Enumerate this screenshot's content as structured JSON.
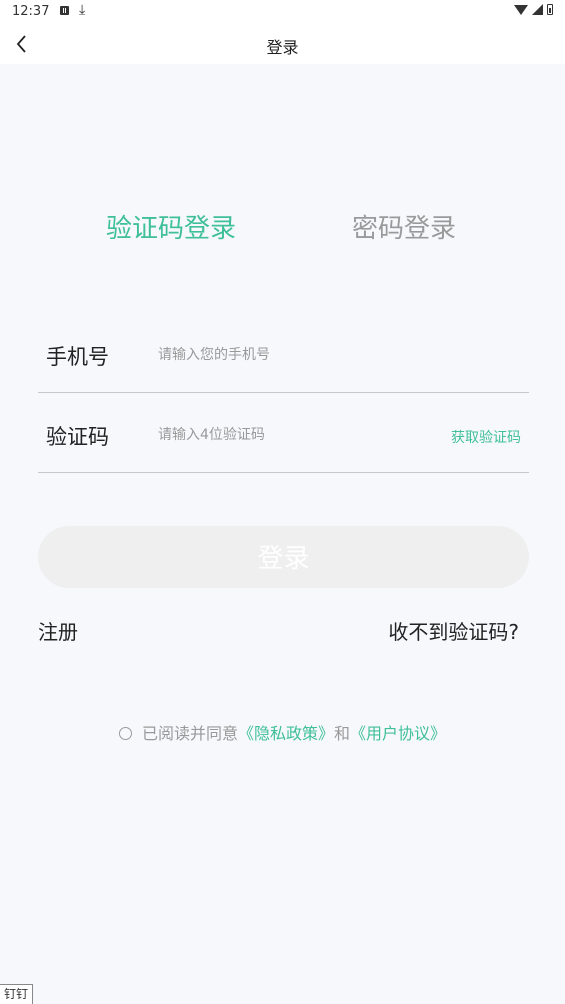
{
  "status_bar": {
    "time": "12:37"
  },
  "nav": {
    "title": "登录"
  },
  "tabs": [
    {
      "label": "验证码登录",
      "active": true
    },
    {
      "label": "密码登录",
      "active": false
    }
  ],
  "form": {
    "phone": {
      "label": "手机号",
      "placeholder": "请输入您的手机号",
      "value": ""
    },
    "code": {
      "label": "验证码",
      "placeholder": "请输入4位验证码",
      "value": ""
    },
    "get_code_label": "获取验证码"
  },
  "login_button_label": "登录",
  "register_label": "注册",
  "no_code_label": "收不到验证码?",
  "agreement": {
    "text": "已阅读并同意",
    "privacy_link": "《隐私政策》",
    "and_text": "和",
    "user_agreement_link": "《用户协议》",
    "checked": false
  },
  "corner_tag": "钉钉",
  "colors": {
    "accent": "#3fbf9a",
    "inactive_tab": "#9a9a9a",
    "background": "#f7f8fc",
    "button_disabled": "#efefef"
  }
}
